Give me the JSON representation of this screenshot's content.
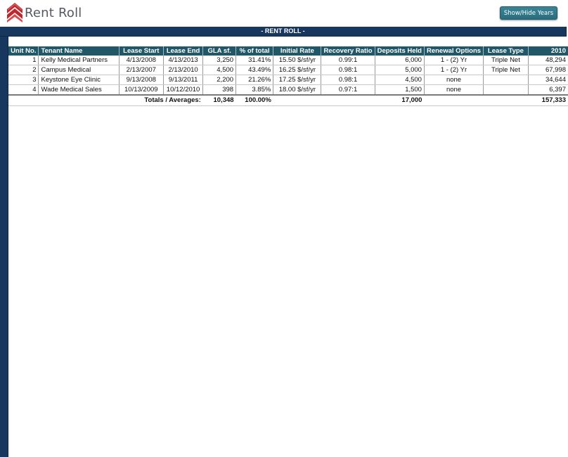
{
  "header": {
    "app_title": "Rent Roll",
    "logo_icon": "red-double-chevron-up-logo",
    "toggle_button_label": "Show/Hide Years"
  },
  "banner": {
    "title": "- RENT ROLL -"
  },
  "colors": {
    "frame": "#17375e",
    "table_header": "#205867",
    "button": "#2f7a8b",
    "logo_red": "#c0272d"
  },
  "table": {
    "columns": [
      "Unit No.",
      "Tenant Name",
      "Lease Start",
      "Lease End",
      "GLA sf.",
      "% of total",
      "Initial Rate",
      "Recovery Ratio",
      "Deposits Held",
      "Renewal Options",
      "Lease Type",
      "2010"
    ],
    "rows": [
      {
        "unit": "1",
        "tenant": "Kelly Medical Partners",
        "lease_start": "4/13/2008",
        "lease_end": "4/13/2013",
        "gla": "3,250",
        "pct": "31.41%",
        "rate": "15.50 $/sf/yr",
        "recovery": "0.99:1",
        "deposit": "6,000",
        "renewal": "1 - (2) Yr",
        "lease_type": "Triple Net",
        "y2010": "48,294"
      },
      {
        "unit": "2",
        "tenant": "Campus Medical",
        "lease_start": "2/13/2007",
        "lease_end": "2/13/2010",
        "gla": "4,500",
        "pct": "43.49%",
        "rate": "16.25 $/sf/yr",
        "recovery": "0.98:1",
        "deposit": "5,000",
        "renewal": "1 - (2) Yr",
        "lease_type": "Triple Net",
        "y2010": "67,998"
      },
      {
        "unit": "3",
        "tenant": "Keystone Eye Clinic",
        "lease_start": "9/13/2008",
        "lease_end": "9/13/2011",
        "gla": "2,200",
        "pct": "21.26%",
        "rate": "17.25 $/sf/yr",
        "recovery": "0.98:1",
        "deposit": "4,500",
        "renewal": "none",
        "lease_type": "",
        "y2010": "34,644"
      },
      {
        "unit": "4",
        "tenant": "Wade Medical Sales",
        "lease_start": "10/13/2009",
        "lease_end": "10/12/2010",
        "gla": "398",
        "pct": "3.85%",
        "rate": "18.00 $/sf/yr",
        "recovery": "0.97:1",
        "deposit": "1,500",
        "renewal": "none",
        "lease_type": "",
        "y2010": "6,397"
      }
    ],
    "totals": {
      "label": "Totals / Averages:",
      "gla": "10,348",
      "pct": "100.00%",
      "deposit": "17,000",
      "y2010": "157,333"
    }
  }
}
